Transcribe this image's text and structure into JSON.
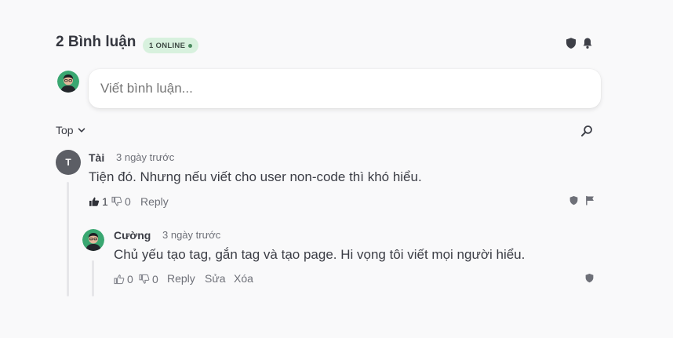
{
  "header": {
    "title": "2 Bình luận",
    "online_badge": "1 ONLINE"
  },
  "composer": {
    "placeholder": "Viết bình luận..."
  },
  "sort": {
    "label": "Top"
  },
  "comments": [
    {
      "avatar_letter": "T",
      "author": "Tài",
      "time": "3 ngày trước",
      "text": "Tiện đó. Nhưng nếu viết cho user non-code thì khó hiểu.",
      "likes": "1",
      "dislikes": "0",
      "reply_label": "Reply"
    },
    {
      "author": "Cường",
      "time": "3 ngày trước",
      "text": "Chủ yếu tạo tag, gắn tag và tạo page. Hi vọng tôi viết mọi người hiểu.",
      "likes": "0",
      "dislikes": "0",
      "reply_label": "Reply",
      "edit_label": "Sửa",
      "delete_label": "Xóa"
    }
  ],
  "colors": {
    "background": "#f9f9fa",
    "badge_bg": "#d8f1de",
    "text": "#3b3d45",
    "muted": "#6e7078",
    "icon": "#4a4c54"
  },
  "icons": [
    "shield-icon",
    "bell-icon",
    "search-icon",
    "chevron-down-icon",
    "thumb-up-icon",
    "thumb-down-icon",
    "flag-icon"
  ]
}
